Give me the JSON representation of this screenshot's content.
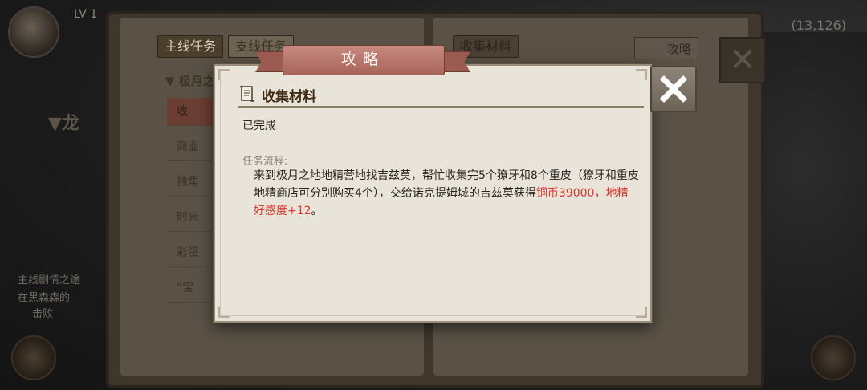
{
  "hud": {
    "level_text": "LV 1",
    "coords": "(13,126)"
  },
  "book_tabs": {
    "main_quest": "主线任务",
    "side_quest": "支线任务",
    "collect": "收集材料",
    "guide_btn": "攻略"
  },
  "book_left": {
    "category": "▼ 极月之",
    "items": [
      "收",
      "商业",
      "独角",
      "时光",
      "彩蛋",
      "“宝"
    ]
  },
  "bg_left": {
    "big_label": "▼龙",
    "line1": "主线剧情之途",
    "line2": "在黑森森的",
    "line3": "击败"
  },
  "modal": {
    "title": "攻略",
    "section_title": "收集材料",
    "status": "已完成",
    "flow_label": "任务流程:",
    "desc_part1": "来到极月之地地精营地找吉兹莫，帮忙收集完5个獠牙和8个重皮（獠牙和重皮地精商店可分别购买4个），交给诺克提姆城的吉兹莫获得",
    "desc_highlight": "铜币39000，地精好感度+12",
    "desc_end": "。"
  },
  "colors": {
    "highlight": "#e0332a",
    "ribbon": "#b0695e",
    "paper": "#e9e4da"
  }
}
